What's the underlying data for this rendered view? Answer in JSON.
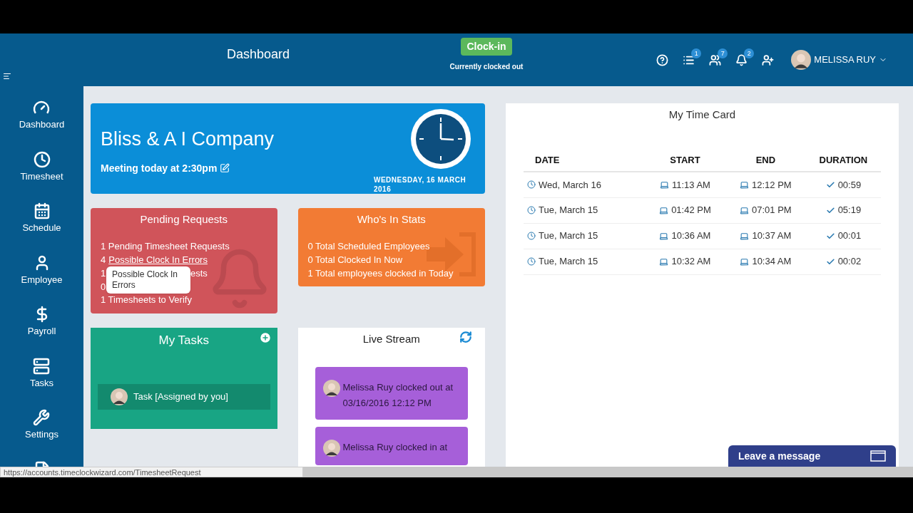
{
  "header": {
    "title": "Dashboard",
    "clock_button": "Clock-in",
    "clock_status": "Currently clocked out",
    "user": "MELISSA RUY"
  },
  "header_icons": [
    {
      "kind": "help"
    },
    {
      "kind": "list",
      "badge": "1"
    },
    {
      "kind": "users",
      "badge": "7"
    },
    {
      "kind": "bell",
      "badge": "2"
    },
    {
      "kind": "add-user"
    }
  ],
  "sidebar": [
    {
      "kind": "dashboard",
      "label": "Dashboard"
    },
    {
      "kind": "clock",
      "label": "Timesheet"
    },
    {
      "kind": "calendar",
      "label": "Schedule"
    },
    {
      "kind": "user",
      "label": "Employee"
    },
    {
      "kind": "dollar",
      "label": "Payroll"
    },
    {
      "kind": "tasks",
      "label": "Tasks"
    },
    {
      "kind": "wrench",
      "label": "Settings"
    },
    {
      "kind": "file"
    }
  ],
  "banner": {
    "company": "Bliss & A I Company",
    "note": "Meeting today at 2:30pm",
    "date": "WEDNESDAY, 16 MARCH 2016"
  },
  "pending": {
    "title": "Pending Requests",
    "lines": [
      {
        "kind": "text",
        "text": "1 Pending Timesheet Requests"
      },
      {
        "kind": "link",
        "count": "4",
        "text": "Possible Clock In Errors"
      }
    ],
    "covered_counts": [
      "1",
      "0"
    ],
    "covered_tail": "ests",
    "tooltip": "Possible Clock In Errors",
    "last_line": "1 Timesheets to Verify"
  },
  "whos_in": {
    "title": "Who's In Stats",
    "lines": [
      "0 Total Scheduled Employees",
      "0 Total Clocked In Now",
      "1 Total employees clocked in Today"
    ]
  },
  "tasks": {
    "title": "My Tasks",
    "items": [
      "Task [Assigned by you]"
    ]
  },
  "live_stream": {
    "title": "Live Stream",
    "items": [
      "Melissa Ruy clocked out at 03/16/2016 12:12 PM",
      "Melissa Ruy clocked in at"
    ]
  },
  "time_card": {
    "title": "My Time Card",
    "columns": [
      "DATE",
      "START",
      "END",
      "DURATION"
    ],
    "rows": [
      {
        "date": "Wed, March 16",
        "start": "11:13 AM",
        "end": "12:12 PM",
        "duration": "00:59"
      },
      {
        "date": "Tue, March 15",
        "start": "01:42 PM",
        "end": "07:01 PM",
        "duration": "05:19"
      },
      {
        "date": "Tue, March 15",
        "start": "10:36 AM",
        "end": "10:37 AM",
        "duration": "00:01"
      },
      {
        "date": "Tue, March 15",
        "start": "10:32 AM",
        "end": "10:34 AM",
        "duration": "00:02"
      }
    ]
  },
  "chat": {
    "label": "Leave a message"
  },
  "status_url": "https://accounts.timeclockwizard.com/TimesheetRequest"
}
